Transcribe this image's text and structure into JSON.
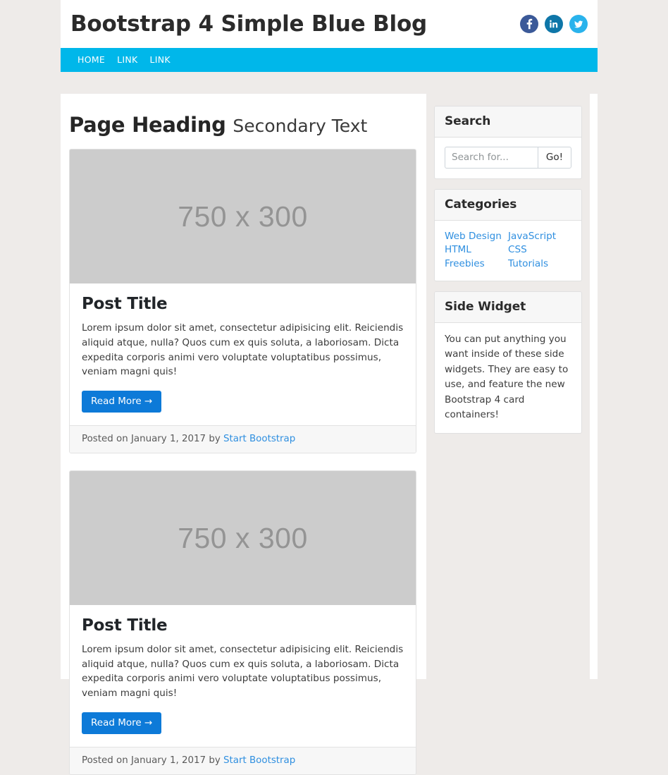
{
  "header": {
    "brand": "Bootstrap 4 Simple Blue Blog",
    "social": [
      {
        "name": "facebook",
        "label": "Facebook",
        "color": "#3b5998"
      },
      {
        "name": "linkedin",
        "label": "LinkedIn",
        "color": "#0e76a8"
      },
      {
        "name": "twitter",
        "label": "Twitter",
        "color": "#2ab3ec"
      }
    ]
  },
  "nav": {
    "accent_color": "#00b7ea",
    "items": [
      {
        "label": "HOME"
      },
      {
        "label": "LINK"
      },
      {
        "label": "LINK"
      }
    ]
  },
  "main": {
    "heading": "Page Heading",
    "heading_secondary": "Secondary Text",
    "posts": [
      {
        "thumb_label": "750 x 300",
        "title": "Post Title",
        "text": "Lorem ipsum dolor sit amet, consectetur adipisicing elit. Reiciendis aliquid atque, nulla? Quos cum ex quis soluta, a laboriosam. Dicta expedita corporis animi vero voluptate voluptatibus possimus, veniam magni quis!",
        "button_label": "Read More →",
        "footer_prefix": "Posted on January 1, 2017 by",
        "footer_author": "Start Bootstrap"
      },
      {
        "thumb_label": "750 x 300",
        "title": "Post Title",
        "text": "Lorem ipsum dolor sit amet, consectetur adipisicing elit. Reiciendis aliquid atque, nulla? Quos cum ex quis soluta, a laboriosam. Dicta expedita corporis animi vero voluptate voluptatibus possimus, veniam magni quis!",
        "button_label": "Read More →",
        "footer_prefix": "Posted on January 1, 2017 by",
        "footer_author": "Start Bootstrap"
      }
    ]
  },
  "sidebar": {
    "search": {
      "title": "Search",
      "placeholder": "Search for...",
      "value": "",
      "button_label": "Go!"
    },
    "categories": {
      "title": "Categories",
      "col1": [
        {
          "label": "Web Design"
        },
        {
          "label": "HTML"
        },
        {
          "label": "Freebies"
        }
      ],
      "col2": [
        {
          "label": "JavaScript"
        },
        {
          "label": "CSS"
        },
        {
          "label": "Tutorials"
        }
      ]
    },
    "side_widget": {
      "title": "Side Widget",
      "text": "You can put anything you want inside of these side widgets. They are easy to use, and feature the new Bootstrap 4 card containers!"
    }
  },
  "colors": {
    "page_background": "#eeebe9",
    "nav_cyan": "#00b7ea",
    "primary_button": "#0d7ad8",
    "link_blue": "#2f8fe0",
    "thumb_gray": "#cccccc"
  }
}
